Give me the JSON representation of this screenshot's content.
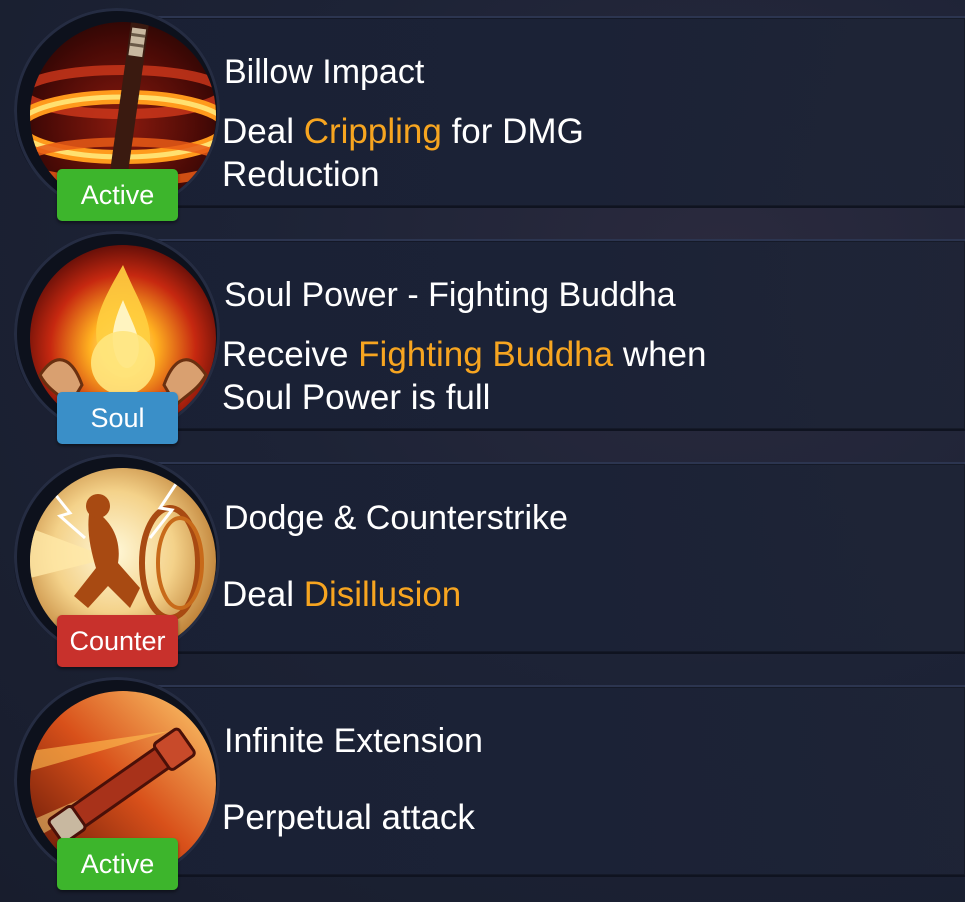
{
  "skills": [
    {
      "title": "Billow Impact",
      "badge": "Active",
      "badge_color": "#3db52c",
      "icon": "staff-spin-icon",
      "desc_pre": "Deal ",
      "desc_highlight": "Crippling",
      "desc_post1": " for DMG",
      "desc_post2": "Reduction"
    },
    {
      "title": "Soul Power - Fighting Buddha",
      "badge": "Soul",
      "badge_color": "#3a8fc8",
      "icon": "flame-hands-icon",
      "desc_pre": "Receive ",
      "desc_highlight": "Fighting Buddha",
      "desc_post1": " when",
      "desc_post2": "Soul Power is full"
    },
    {
      "title": "Dodge & Counterstrike",
      "badge": "Counter",
      "badge_color": "#c8312c",
      "icon": "counterstrike-icon",
      "desc_pre": "Deal ",
      "desc_highlight": "Disillusion",
      "desc_post1": "",
      "desc_post2": ""
    },
    {
      "title": "Infinite Extension",
      "badge": "Active",
      "badge_color": "#3db52c",
      "icon": "extending-staff-icon",
      "desc_pre": "Perpetual attack",
      "desc_highlight": "",
      "desc_post1": "",
      "desc_post2": ""
    }
  ],
  "colors": {
    "highlight": "#f7a520",
    "text": "#ffffff",
    "background": "#1c2234"
  }
}
